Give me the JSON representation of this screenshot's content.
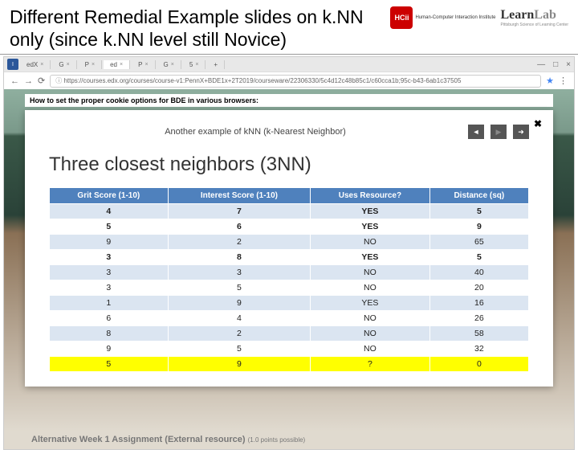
{
  "slide": {
    "title": "Different Remedial Example slides on k.NN only (since k.NN level still Novice)"
  },
  "logos": {
    "hcii_badge": "HCii",
    "hcii_text": "Human-Computer Interaction Institute",
    "learnlab_a": "Learn",
    "learnlab_b": "Lab",
    "learnlab_sub": "Pittsburgh Science of Learning Center"
  },
  "browser": {
    "tabs": [
      "edX",
      "G",
      "P",
      "ed",
      "P",
      "G",
      "5"
    ],
    "url": "https://courses.edx.org/courses/course-v1:PennX+BDE1x+2T2019/courseware/22306330/5c4d12c48b85c1/c60cca1b;95c-b43-6ab1c37505",
    "new_tab": "+"
  },
  "page": {
    "cookie_text": "How to set the proper cookie options for BDE in various browsers:"
  },
  "embed": {
    "header": "Another example of kNN (k-Nearest Neighbor)",
    "title": "Three closest neighbors (3NN)",
    "prev": "◄",
    "play": "▶",
    "next": "➜",
    "close": "✖"
  },
  "alt": {
    "label": "Alternative Week 1 Assignment (External resource)",
    "pts": "(1.0 points possible)"
  },
  "chart_data": {
    "type": "table",
    "headers": [
      "Grit Score (1-10)",
      "Interest Score (1-10)",
      "Uses Resource?",
      "Distance (sq)"
    ],
    "rows": [
      {
        "grit": "4",
        "interest": "7",
        "uses": "YES",
        "dist": "5",
        "kind": "red"
      },
      {
        "grit": "5",
        "interest": "6",
        "uses": "YES",
        "dist": "9",
        "kind": "red"
      },
      {
        "grit": "9",
        "interest": "2",
        "uses": "NO",
        "dist": "65",
        "kind": ""
      },
      {
        "grit": "3",
        "interest": "8",
        "uses": "YES",
        "dist": "5",
        "kind": "red"
      },
      {
        "grit": "3",
        "interest": "3",
        "uses": "NO",
        "dist": "40",
        "kind": ""
      },
      {
        "grit": "3",
        "interest": "5",
        "uses": "NO",
        "dist": "20",
        "kind": ""
      },
      {
        "grit": "1",
        "interest": "9",
        "uses": "YES",
        "dist": "16",
        "kind": ""
      },
      {
        "grit": "6",
        "interest": "4",
        "uses": "NO",
        "dist": "26",
        "kind": ""
      },
      {
        "grit": "8",
        "interest": "2",
        "uses": "NO",
        "dist": "58",
        "kind": ""
      },
      {
        "grit": "9",
        "interest": "5",
        "uses": "NO",
        "dist": "32",
        "kind": ""
      },
      {
        "grit": "5",
        "interest": "9",
        "uses": "?",
        "dist": "0",
        "kind": "hilite"
      }
    ]
  }
}
